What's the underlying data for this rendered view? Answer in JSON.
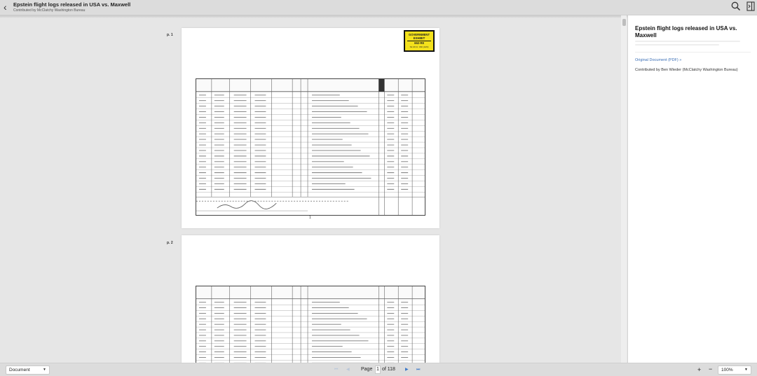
{
  "header": {
    "title": "Epstein flight logs released in USA vs. Maxwell",
    "subtitle": "Contributed by McClatchy Washington Bureau",
    "back_icon": "chevron-left-icon",
    "search_icon": "search-icon",
    "panel_icon": "sidebar-toggle-icon"
  },
  "viewer": {
    "pages": [
      {
        "label": "p. 1",
        "stamp": [
          "GOVERNMENT",
          "EXHIBIT",
          "662-R8",
          "S2 20 Cr. 330 (AJN)"
        ],
        "number": "1"
      },
      {
        "label": "p. 2"
      }
    ]
  },
  "sidebar": {
    "title": "Epstein flight logs released in USA vs. Maxwell",
    "original_link": "Original Document (PDF) »",
    "contributor": "Contributed by Ben Wieder (McClatchy Washington Bureau)"
  },
  "footer": {
    "mode": "Document",
    "page_word": "Page",
    "current_page": "1",
    "total": "of 118",
    "zoom": "100%",
    "zoom_in": "+",
    "zoom_out": "−"
  }
}
